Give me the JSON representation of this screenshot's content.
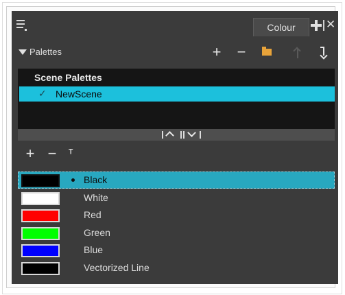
{
  "header": {
    "menu_icon": "hamburger-menu-icon",
    "tab_label": "Colour",
    "add_view_icon": "plus-icon",
    "close_icon": "close-icon"
  },
  "palettes": {
    "label": "Palettes",
    "toolbar": {
      "add": "+",
      "remove": "−",
      "folder_icon": "folder-icon",
      "move_up_icon": "arrow-up-icon",
      "move_down_icon": "arrow-down-icon"
    },
    "list_header": "Scene Palettes",
    "items": [
      {
        "name": "NewScene",
        "checked": true,
        "selected": true
      }
    ]
  },
  "swatch_toolbar": {
    "add": "+",
    "remove": "−",
    "tint_icon": "tint-offset-icon",
    "tint_glyph": "ᵀ"
  },
  "colours": [
    {
      "name": "Black",
      "color": "#000000",
      "selected": true
    },
    {
      "name": "White",
      "color": "#ffffff",
      "selected": false
    },
    {
      "name": "Red",
      "color": "#ff0000",
      "selected": false
    },
    {
      "name": "Green",
      "color": "#00ff00",
      "selected": false
    },
    {
      "name": "Blue",
      "color": "#0000ff",
      "selected": false
    },
    {
      "name": "Vectorized Line",
      "color": "#000000",
      "selected": false
    }
  ],
  "theme": {
    "panel_bg": "#3b3b3b",
    "selection": "#1cc0dc",
    "list_bg": "#151515"
  }
}
